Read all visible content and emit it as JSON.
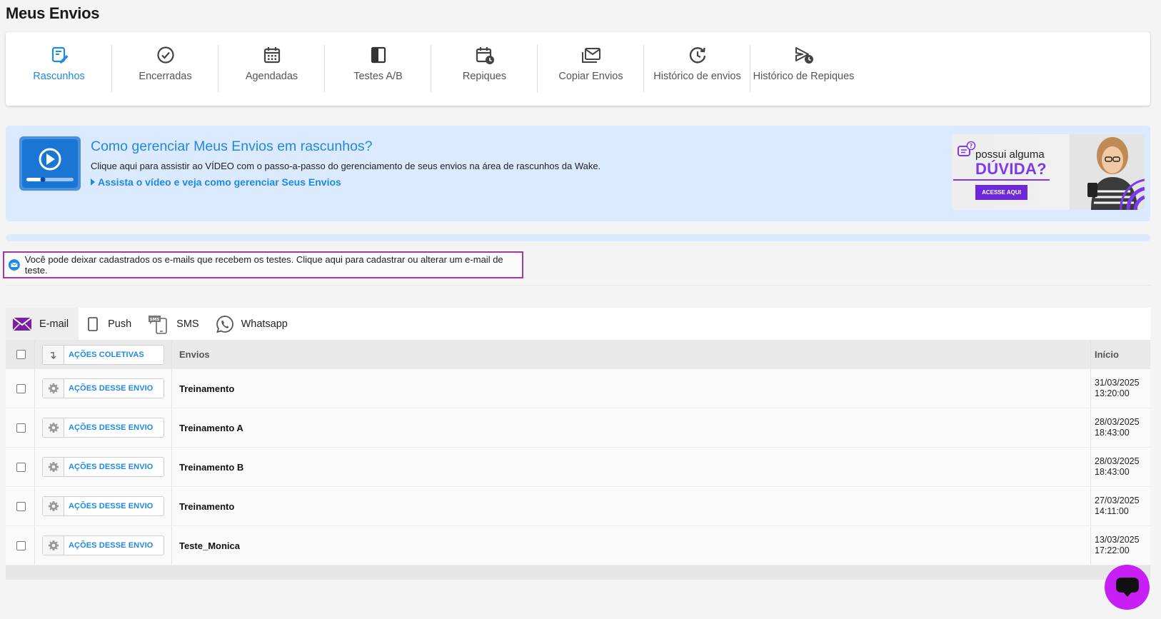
{
  "page": {
    "title": "Meus Envios"
  },
  "nav": {
    "items": [
      {
        "label": "Rascunhos",
        "icon": "drafts-icon",
        "active": true
      },
      {
        "label": "Encerradas",
        "icon": "check-circle-icon"
      },
      {
        "label": "Agendadas",
        "icon": "calendar-icon"
      },
      {
        "label": "Testes A/B",
        "icon": "ab-test-icon"
      },
      {
        "label": "Repiques",
        "icon": "calendar-clock-icon"
      },
      {
        "label": "Copiar Envios",
        "icon": "mail-copy-icon"
      },
      {
        "label": "Histórico de envios",
        "icon": "history-icon"
      },
      {
        "label": "Histórico de Repiques",
        "icon": "send-clock-icon"
      }
    ]
  },
  "banner": {
    "title": "Como gerenciar Meus Envios em rascunhos?",
    "description": "Clique aqui para assistir ao VÍDEO com o passo-a-passo do gerenciamento de seus envios na área de rascunhos da Wake.",
    "link": "Assista o vídeo e veja como gerenciar Seus Envios",
    "promo": {
      "line1": "possui alguma",
      "line2": "DÚVIDA?",
      "button": "ACESSE AQUI"
    }
  },
  "notice": {
    "text": "Você pode deixar cadastrados os e-mails que recebem os testes. Clique aqui para cadastrar ou alterar um e-mail de teste."
  },
  "channels": [
    {
      "label": "E-mail",
      "active": true
    },
    {
      "label": "Push"
    },
    {
      "label": "SMS"
    },
    {
      "label": "Whatsapp"
    }
  ],
  "table": {
    "bulk_actions": "AÇÕES COLETIVAS",
    "row_action": "AÇÕES DESSE ENVIO",
    "columns": {
      "envios": "Envios",
      "inicio": "Início"
    },
    "rows": [
      {
        "name": "Treinamento",
        "date": "31/03/2025",
        "time": "13:20:00"
      },
      {
        "name": "Treinamento A",
        "date": "28/03/2025",
        "time": "18:43:00"
      },
      {
        "name": "Treinamento B",
        "date": "28/03/2025",
        "time": "18:43:00"
      },
      {
        "name": "Treinamento",
        "date": "27/03/2025",
        "time": "14:11:00"
      },
      {
        "name": "Teste_Monica",
        "date": "13/03/2025",
        "time": "17:22:00"
      }
    ]
  },
  "colors": {
    "accent": "#1e88e5",
    "brand_purple": "#7c3aed",
    "chat": "#c81ff5",
    "notice_border": "#9c3c9c"
  }
}
